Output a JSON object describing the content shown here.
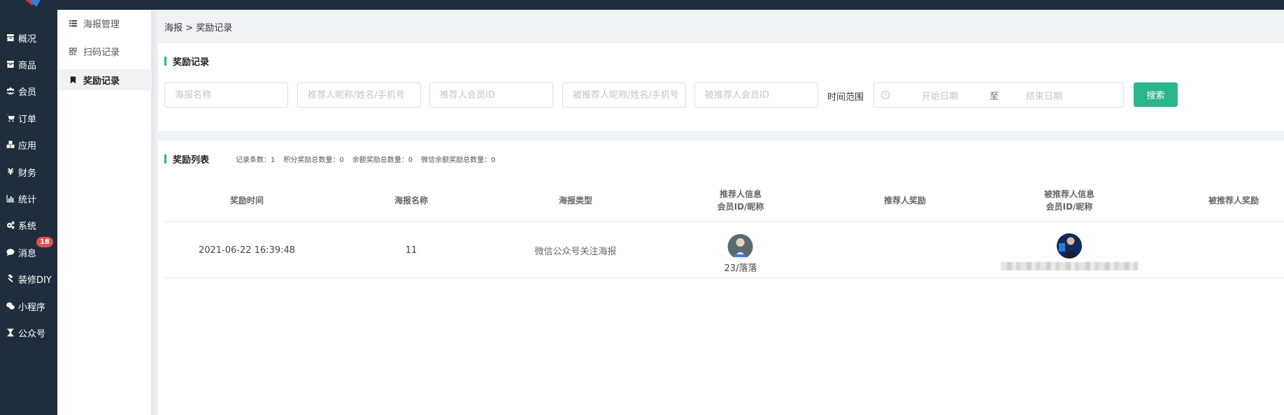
{
  "nav": {
    "items": [
      {
        "label": "概况",
        "icon": "archive-icon"
      },
      {
        "label": "商品",
        "icon": "box-icon"
      },
      {
        "label": "会员",
        "icon": "users-icon"
      },
      {
        "label": "订单",
        "icon": "cart-icon"
      },
      {
        "label": "应用",
        "icon": "cubes-icon"
      },
      {
        "label": "财务",
        "icon": "yen-icon"
      },
      {
        "label": "统计",
        "icon": "bar-chart-icon"
      },
      {
        "label": "系统",
        "icon": "gears-icon"
      },
      {
        "label": "消息",
        "icon": "chat-icon",
        "badge": "18"
      },
      {
        "label": "装修DIY",
        "icon": "gavel-icon"
      },
      {
        "label": "小程序",
        "icon": "wechat-icon"
      },
      {
        "label": "公众号",
        "icon": "hourglass-icon"
      }
    ]
  },
  "subnav": {
    "items": [
      {
        "label": "海报管理",
        "icon": "list-icon"
      },
      {
        "label": "扫码记录",
        "icon": "qrcode-icon"
      },
      {
        "label": "奖励记录",
        "icon": "bookmark-icon"
      }
    ]
  },
  "breadcrumb": {
    "parent": "海报",
    "separator": " > ",
    "current": "奖励记录"
  },
  "filter_panel": {
    "title": "奖励记录",
    "poster_name_placeholder": "海报名称",
    "referrer_placeholder": "推荐人昵称/姓名/手机号",
    "referrer_id_placeholder": "推荐人会员ID",
    "referee_placeholder": "被推荐人昵称/姓名/手机号",
    "referee_id_placeholder": "被推荐人会员ID",
    "time_label": "时间范围",
    "start_date": "开始日期",
    "to": "至",
    "end_date": "结束日期",
    "search_label": "搜索"
  },
  "list_panel": {
    "title": "奖励列表",
    "stats": [
      "记录条数：1",
      "积分奖励总数量：0",
      "余额奖励总数量：0",
      "微信余额奖励总数量：0"
    ],
    "columns": [
      {
        "line1": "奖励时间",
        "line2": ""
      },
      {
        "line1": "海报名称",
        "line2": ""
      },
      {
        "line1": "海报类型",
        "line2": ""
      },
      {
        "line1": "推荐人信息",
        "line2": "会员ID/昵称"
      },
      {
        "line1": "推荐人奖励",
        "line2": ""
      },
      {
        "line1": "被推荐人信息",
        "line2": "会员ID/昵称"
      },
      {
        "line1": "被推荐人奖励",
        "line2": ""
      }
    ],
    "rows": [
      {
        "time": "2021-06-22 16:39:48",
        "poster_name": "11",
        "poster_type": "微信公众号关注海报",
        "referrer": "23/落落",
        "referrer_reward": "",
        "referee": "",
        "referee_reward": ""
      }
    ]
  },
  "colors": {
    "accent": "#2bb58d",
    "nav_bg": "#1f2d3d",
    "badge": "#e94e4e"
  }
}
